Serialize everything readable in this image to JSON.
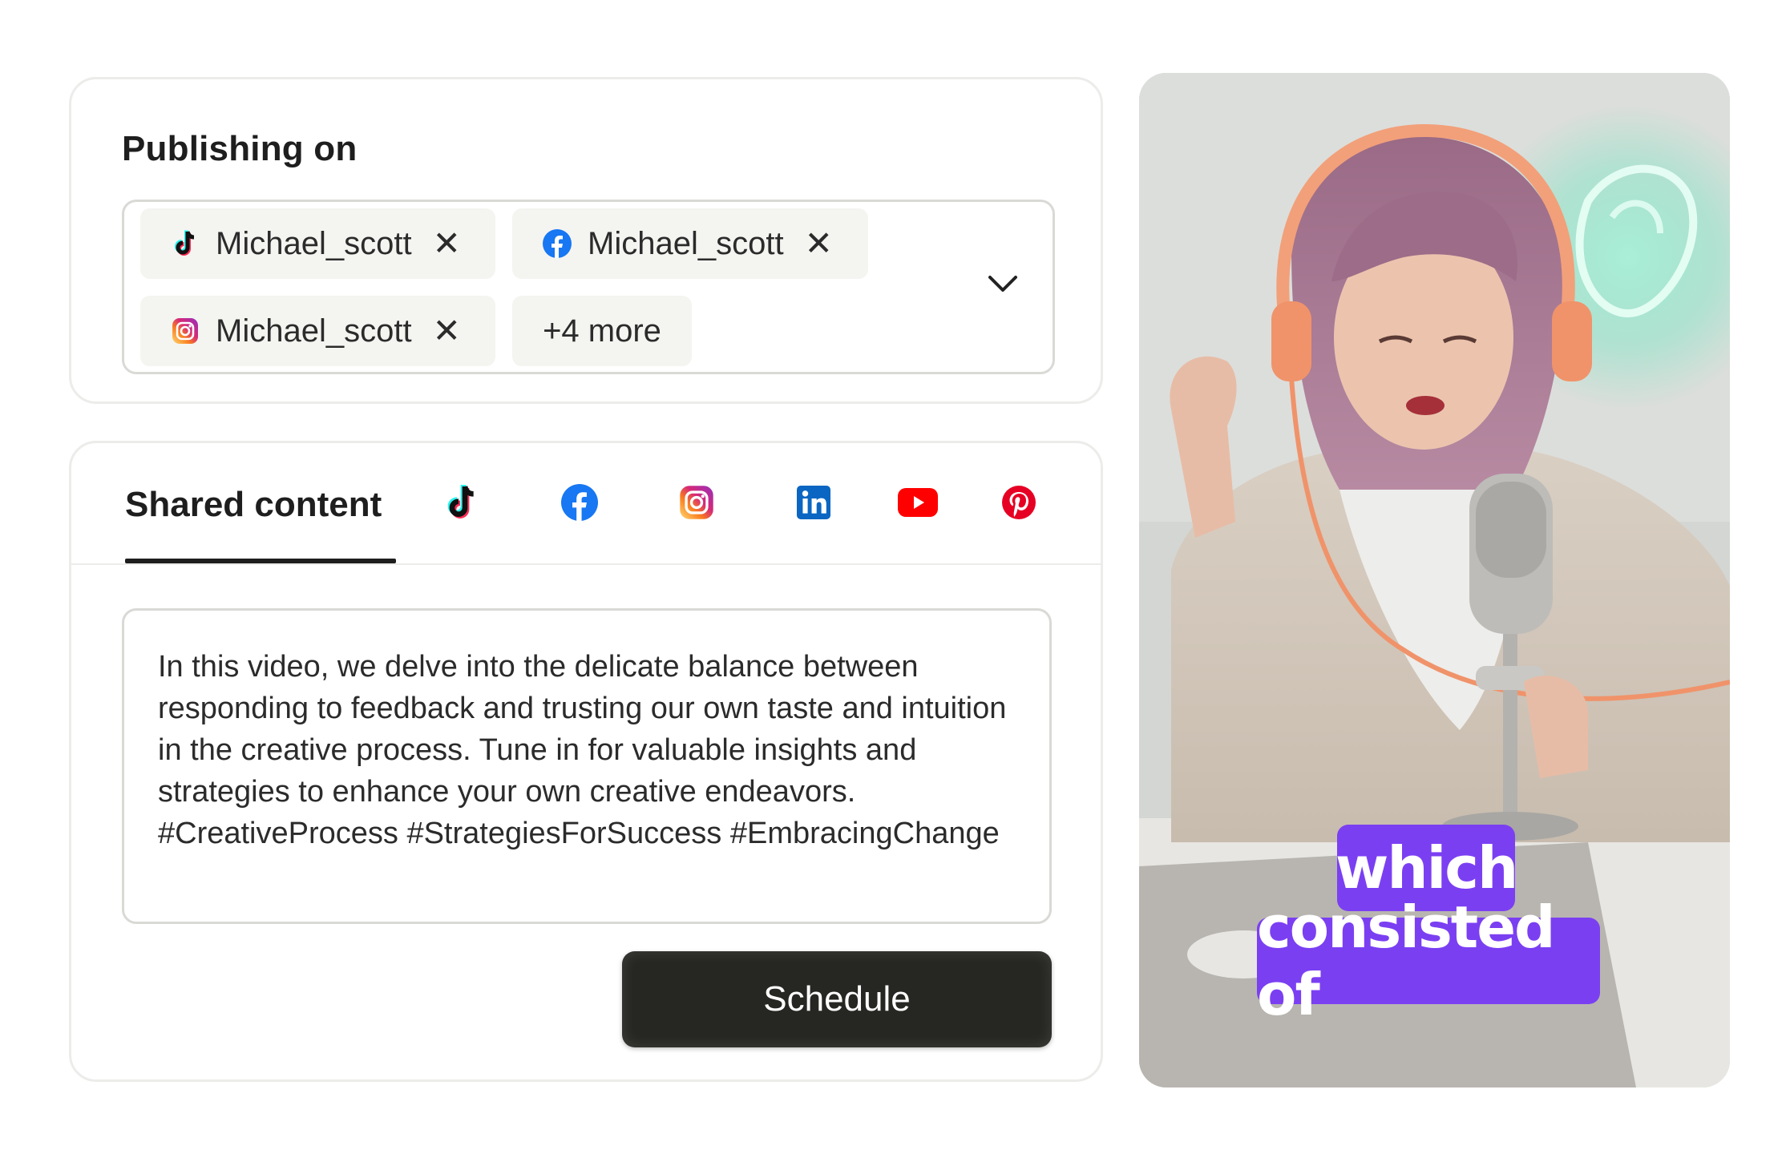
{
  "publishing": {
    "title": "Publishing on",
    "accounts": [
      {
        "platform": "tiktok-icon",
        "name": "Michael_scott"
      },
      {
        "platform": "facebook-icon",
        "name": "Michael_scott"
      },
      {
        "platform": "instagram-icon",
        "name": "Michael_scott"
      }
    ],
    "more_label": "+4 more"
  },
  "shared": {
    "tab_label": "Shared content",
    "platform_tabs": [
      "tiktok-icon",
      "facebook-icon",
      "instagram-icon",
      "linkedin-icon",
      "youtube-icon",
      "pinterest-icon"
    ],
    "caption": "In this video, we delve into the delicate balance between responding to feedback and trusting our own taste and intuition in the creative process. Tune in for valuable insights and strategies to enhance your own creative endeavors. #CreativeProcess #StrategiesForSuccess #EmbracingChange",
    "schedule_label": "Schedule"
  },
  "video": {
    "subtitle_line1": "which",
    "subtitle_line2": "consisted of"
  },
  "colors": {
    "subtitle_bg": "#7b3ff2",
    "button_bg": "#262622",
    "facebook": "#1877f2",
    "linkedin": "#0a66c2",
    "youtube": "#ff0000",
    "pinterest": "#e60023"
  }
}
